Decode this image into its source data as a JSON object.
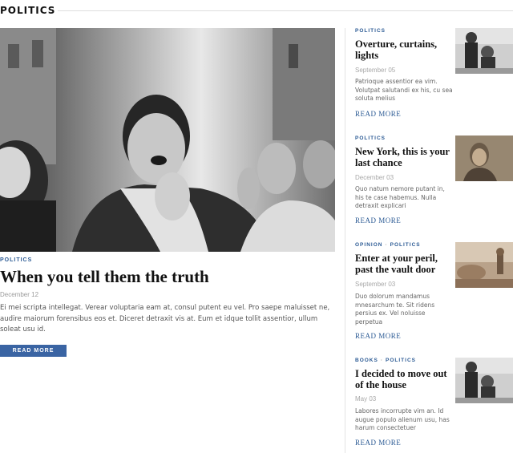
{
  "section": {
    "title": "POLITICS"
  },
  "featured": {
    "category": "POLITICS",
    "title": "When you tell them the truth",
    "date": "December 12",
    "excerpt": "Ei mei scripta intellegat. Verear voluptaria eam at, consul putent eu vel. Pro saepe maluisset ne, audire maiorum forensibus eos et. Diceret detraxit vis at. Eum et idque tollit assentior, ullum soleat usu id.",
    "button_label": "READ MORE"
  },
  "side_posts": [
    {
      "categories": [
        "POLITICS"
      ],
      "title": "Overture, curtains, lights",
      "date": "September 05",
      "excerpt": "Patrioque assentior ea vim. Volutpat salutandi ex his, cu sea soluta melius",
      "more_label": "READ MORE"
    },
    {
      "categories": [
        "POLITICS"
      ],
      "title": "New York, this is your last chance",
      "date": "December 03",
      "excerpt": "Quo natum nemore putant in, his te case habemus. Nulla detraxit explicari",
      "more_label": "READ MORE"
    },
    {
      "categories": [
        "OPINION",
        "POLITICS"
      ],
      "title": "Enter at your peril, past the vault door",
      "date": "September 03",
      "excerpt": "Duo dolorum mandamus mnesarchum te. Sit ridens persius ex. Vel noluisse perpetua",
      "more_label": "READ MORE"
    },
    {
      "categories": [
        "BOOKS",
        "POLITICS"
      ],
      "title": "I decided to move out of the house",
      "date": "May 03",
      "excerpt": "Labores incorrupte vim an. Id augue populo alienum usu, has harum consectetuer",
      "more_label": "READ MORE"
    }
  ],
  "colors": {
    "accent": "#2b5a94",
    "button": "#3a64a3",
    "meta": "#9a9a9a"
  }
}
